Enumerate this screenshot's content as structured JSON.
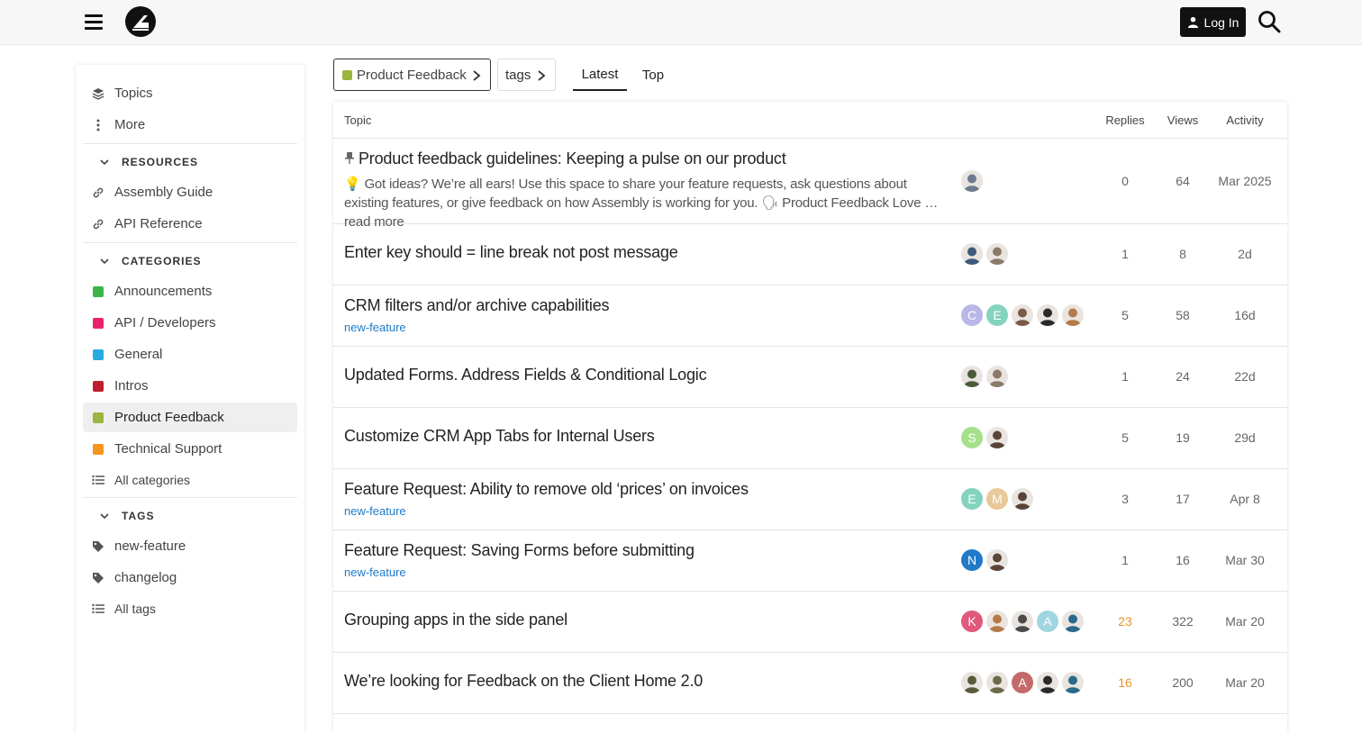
{
  "header": {
    "login_label": "Log In"
  },
  "sidebar": {
    "top_items": [
      {
        "label": "Topics",
        "icon": "layers-icon"
      },
      {
        "label": "More",
        "icon": "vertical-ellipsis-icon"
      }
    ],
    "resources": {
      "heading": "RESOURCES",
      "items": [
        {
          "label": "Assembly Guide",
          "icon": "link-icon"
        },
        {
          "label": "API Reference",
          "icon": "link-icon"
        }
      ]
    },
    "categories": {
      "heading": "CATEGORIES",
      "items": [
        {
          "label": "Announcements",
          "color": "#3ab54a"
        },
        {
          "label": "API / Developers",
          "color": "#e8226f"
        },
        {
          "label": "General",
          "color": "#25aae1"
        },
        {
          "label": "Intros",
          "color": "#bf1e2e"
        },
        {
          "label": "Product Feedback",
          "color": "#9bb53f"
        },
        {
          "label": "Technical Support",
          "color": "#f7941d"
        }
      ],
      "all_label": "All categories"
    },
    "tags": {
      "heading": "TAGS",
      "items": [
        {
          "label": "new-feature",
          "icon": "tag-icon"
        },
        {
          "label": "changelog",
          "icon": "tag-icon"
        }
      ],
      "all_label": "All tags"
    }
  },
  "nav": {
    "category_label": "Product Feedback",
    "category_color": "#9bb53f",
    "tags_label": "tags",
    "tabs": [
      "Latest",
      "Top"
    ]
  },
  "table": {
    "headers": {
      "topic": "Topic",
      "replies": "Replies",
      "views": "Views",
      "activity": "Activity"
    },
    "rows": [
      {
        "title": "Product feedback guidelines: Keeping a pulse on our product",
        "pinned": true,
        "excerpt_main": "💡 Got ideas? We’re all ears! Use this space to share your feature requests, ask questions about existing features, or give feedback on how Assembly is working for you. 🗣 Product Feedback Love … ",
        "excerpt_more": "read more",
        "replies": "0",
        "views": "64",
        "activity": "Mar 2025"
      },
      {
        "title": "Enter key should = line break not post message",
        "replies": "1",
        "views": "8",
        "activity": "2d"
      },
      {
        "title": "CRM filters and/or archive capabilities",
        "tag": "new-feature",
        "replies": "5",
        "views": "58",
        "activity": "16d"
      },
      {
        "title": "Updated Forms. Address Fields & Conditional Logic",
        "replies": "1",
        "views": "24",
        "activity": "22d"
      },
      {
        "title": "Customize CRM App Tabs for Internal Users",
        "replies": "5",
        "views": "19",
        "activity": "29d"
      },
      {
        "title": "Feature Request: Ability to remove old ‘prices’ on invoices",
        "tag": "new-feature",
        "replies": "3",
        "views": "17",
        "activity": "Apr 8"
      },
      {
        "title": "Feature Request: Saving Forms before submitting",
        "tag": "new-feature",
        "replies": "1",
        "views": "16",
        "activity": "Mar 30"
      },
      {
        "title": "Grouping apps in the side panel",
        "replies": "23",
        "views": "322",
        "activity": "Mar 20",
        "hot": true
      },
      {
        "title": "We’re looking for Feedback on the Client Home 2.0",
        "replies": "16",
        "views": "200",
        "activity": "Mar 20",
        "hot": true
      }
    ],
    "posters": [
      [
        {
          "photo": "#6b7a8f"
        }
      ],
      [
        {
          "photo": "#3d5a7a"
        },
        {
          "photo": "#8a7a6a"
        }
      ],
      [
        {
          "letter": "C",
          "bg": "#b9b7e8"
        },
        {
          "letter": "E",
          "bg": "#84d3bd"
        },
        {
          "photo": "#7a5a48"
        },
        {
          "photo": "#2a2a2a"
        },
        {
          "photo": "#b57a4a"
        }
      ],
      [
        {
          "photo": "#4a5a3a"
        },
        {
          "photo": "#8a7a6a"
        }
      ],
      [
        {
          "letter": "S",
          "bg": "#a6e08a"
        },
        {
          "photo": "#5a4438"
        }
      ],
      [
        {
          "letter": "E",
          "bg": "#84d3bd"
        },
        {
          "letter": "M",
          "bg": "#e8c997"
        },
        {
          "photo": "#5a4438"
        }
      ],
      [
        {
          "letter": "N",
          "bg": "#1f7ac7"
        },
        {
          "photo": "#5a4438"
        }
      ],
      [
        {
          "letter": "K",
          "bg": "#e0587a"
        },
        {
          "photo": "#b57a4a"
        },
        {
          "photo": "#4a4a4a"
        },
        {
          "letter": "A",
          "bg": "#9fd6e0"
        },
        {
          "photo": "#2a6a8a"
        }
      ],
      [
        {
          "photo": "#5a5a3a"
        },
        {
          "photo": "#6a6a4a"
        },
        {
          "letter": "A",
          "bg": "#c46a6a"
        },
        {
          "photo": "#2a2a2a"
        },
        {
          "photo": "#2a6a8a"
        }
      ]
    ]
  }
}
